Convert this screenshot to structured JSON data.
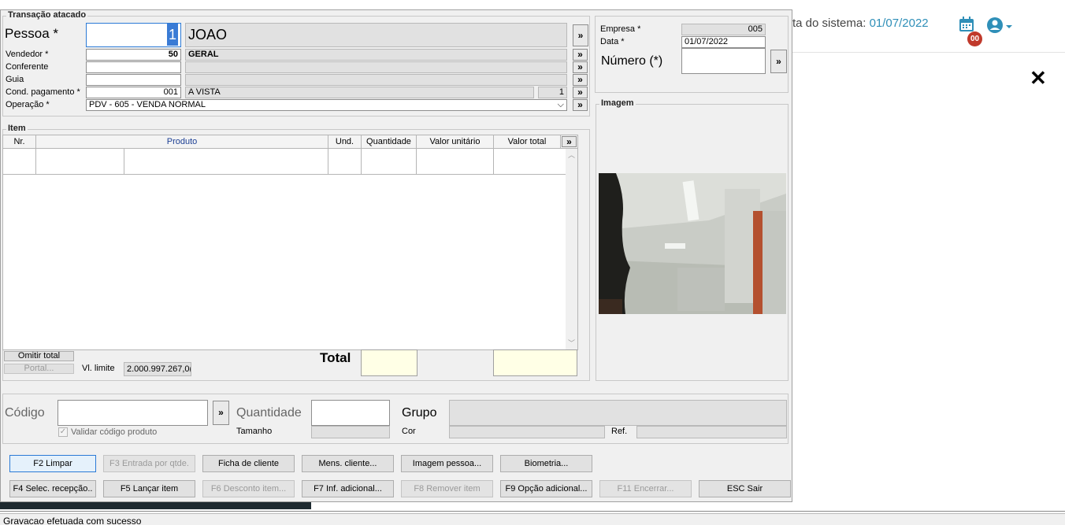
{
  "background": {
    "date_label": "ta do sistema:",
    "date_value": "01/07/2022",
    "calendar_badge": "00",
    "status_text": "Gravacao efetuada com sucesso"
  },
  "header": {
    "title": "Transação atacado",
    "pessoa_label": "Pessoa *",
    "pessoa_code": "1",
    "pessoa_name": "JOAO",
    "vendedor_label": "Vendedor *",
    "vendedor_code": "50",
    "vendedor_name": "GERAL",
    "conferente_label": "Conferente",
    "conferente_code": "",
    "conferente_name": "",
    "guia_label": "Guia",
    "guia_code": "",
    "guia_name": "",
    "cond_label": "Cond. pagamento *",
    "cond_code": "001",
    "cond_name": "A VISTA",
    "cond_parcelas": "1",
    "operacao_label": "Operação *",
    "operacao_value": "PDV - 605 - VENDA NORMAL",
    "more_symbol": "»",
    "combo_arrow": "⌵"
  },
  "empresa": {
    "empresa_label": "Empresa *",
    "empresa_value": "005",
    "data_label": "Data *",
    "data_value": "01/07/2022",
    "numero_label": "Número (*)",
    "numero_value": ""
  },
  "image_panel": {
    "title": "Imagem"
  },
  "items": {
    "title": "Item",
    "columns": [
      "Nr.",
      "Produto",
      "Und.",
      "Quantidade",
      "Valor unitário",
      "Valor total"
    ],
    "rows": [],
    "omitir_total_label": "Omitir total",
    "portal_label": "Portal...",
    "vl_limite_label": "Vl. limite",
    "vl_limite_value": "2.000.997.267,0(",
    "total_label": "Total",
    "total_qty": "",
    "total_value": ""
  },
  "entry": {
    "codigo_label": "Código",
    "codigo_value": "",
    "validar_label": "Validar código produto",
    "quantidade_label": "Quantidade",
    "quantidade_value": "",
    "tamanho_label": "Tamanho",
    "grupo_label": "Grupo",
    "cor_label": "Cor",
    "ref_label": "Ref."
  },
  "buttons_row1": [
    {
      "label": "F2 Limpar"
    },
    {
      "label": "F3 Entrada por qtde."
    },
    {
      "label": "Ficha de cliente"
    },
    {
      "label": "Mens. cliente..."
    },
    {
      "label": "Imagem pessoa..."
    },
    {
      "label": "Biometria..."
    }
  ],
  "buttons_row2": [
    {
      "label": "F4 Selec. recepção.."
    },
    {
      "label": "F5 Lançar item"
    },
    {
      "label": "F6 Desconto item..."
    },
    {
      "label": "F7 Inf. adicional..."
    },
    {
      "label": "F8 Remover item"
    },
    {
      "label": "F9 Opção adicional..."
    },
    {
      "label": "F11 Encerrar..."
    },
    {
      "label": "ESC Sair"
    }
  ],
  "colors": {
    "accent": "#2f8fb8",
    "badge": "#c0392b",
    "dialog_bg": "#f0f0f0",
    "total_fill": "#ffffe6"
  }
}
